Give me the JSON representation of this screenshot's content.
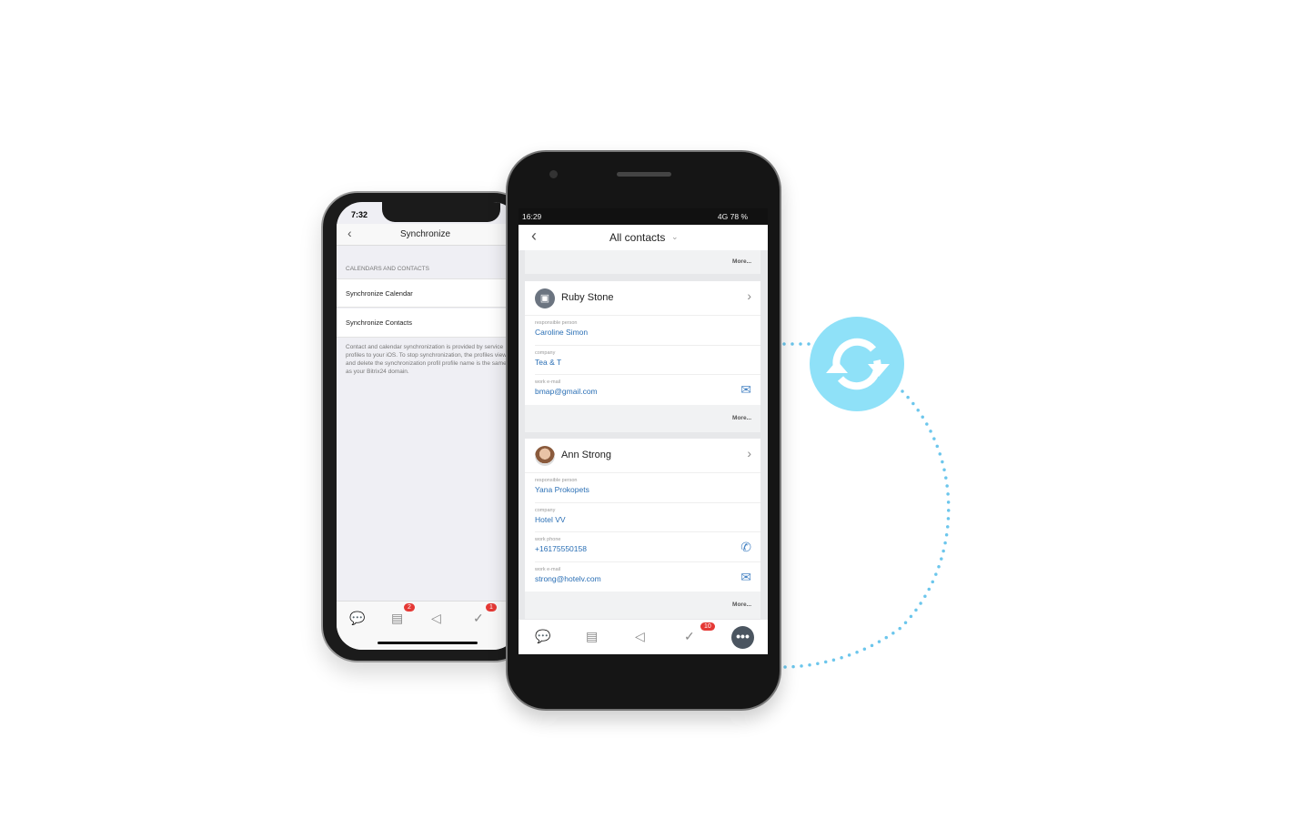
{
  "ios": {
    "time": "7:32",
    "title": "Synchronize",
    "section": "CALENDARS AND CONTACTS",
    "rows": [
      "Synchronize Calendar",
      "Synchronize Contacts"
    ],
    "note": "Contact and calendar synchronization is provided by service profiles to your iOS. To stop synchronization, the profiles view and delete the synchronization profil profile name is the same as your Bitrix24 domain.",
    "badges": [
      "2",
      "1"
    ]
  },
  "android": {
    "time": "16:29",
    "status": "4G 78 %",
    "title": "All contacts",
    "more": "More...",
    "contacts": [
      {
        "name": "Ruby Stone",
        "avatar": "contact-book-icon",
        "fields": [
          {
            "label": "responsible person",
            "value": "Caroline Simon"
          },
          {
            "label": "company",
            "value": "Tea & T"
          },
          {
            "label": "work e-mail",
            "value": "bmap@gmail.com",
            "icon": "mail-icon"
          }
        ]
      },
      {
        "name": "Ann Strong",
        "avatar": "photo",
        "fields": [
          {
            "label": "responsible person",
            "value": "Yana Prokopets"
          },
          {
            "label": "company",
            "value": "Hotel VV"
          },
          {
            "label": "work phone",
            "value": "+16175550158",
            "icon": "phone-icon"
          },
          {
            "label": "work e-mail",
            "value": "strong@hotelv.com",
            "icon": "mail-icon"
          }
        ]
      }
    ],
    "tasks_badge": "10"
  },
  "colors": {
    "sync": "#8fe1f8",
    "link": "#2a6fb5",
    "badge": "#e53935"
  }
}
